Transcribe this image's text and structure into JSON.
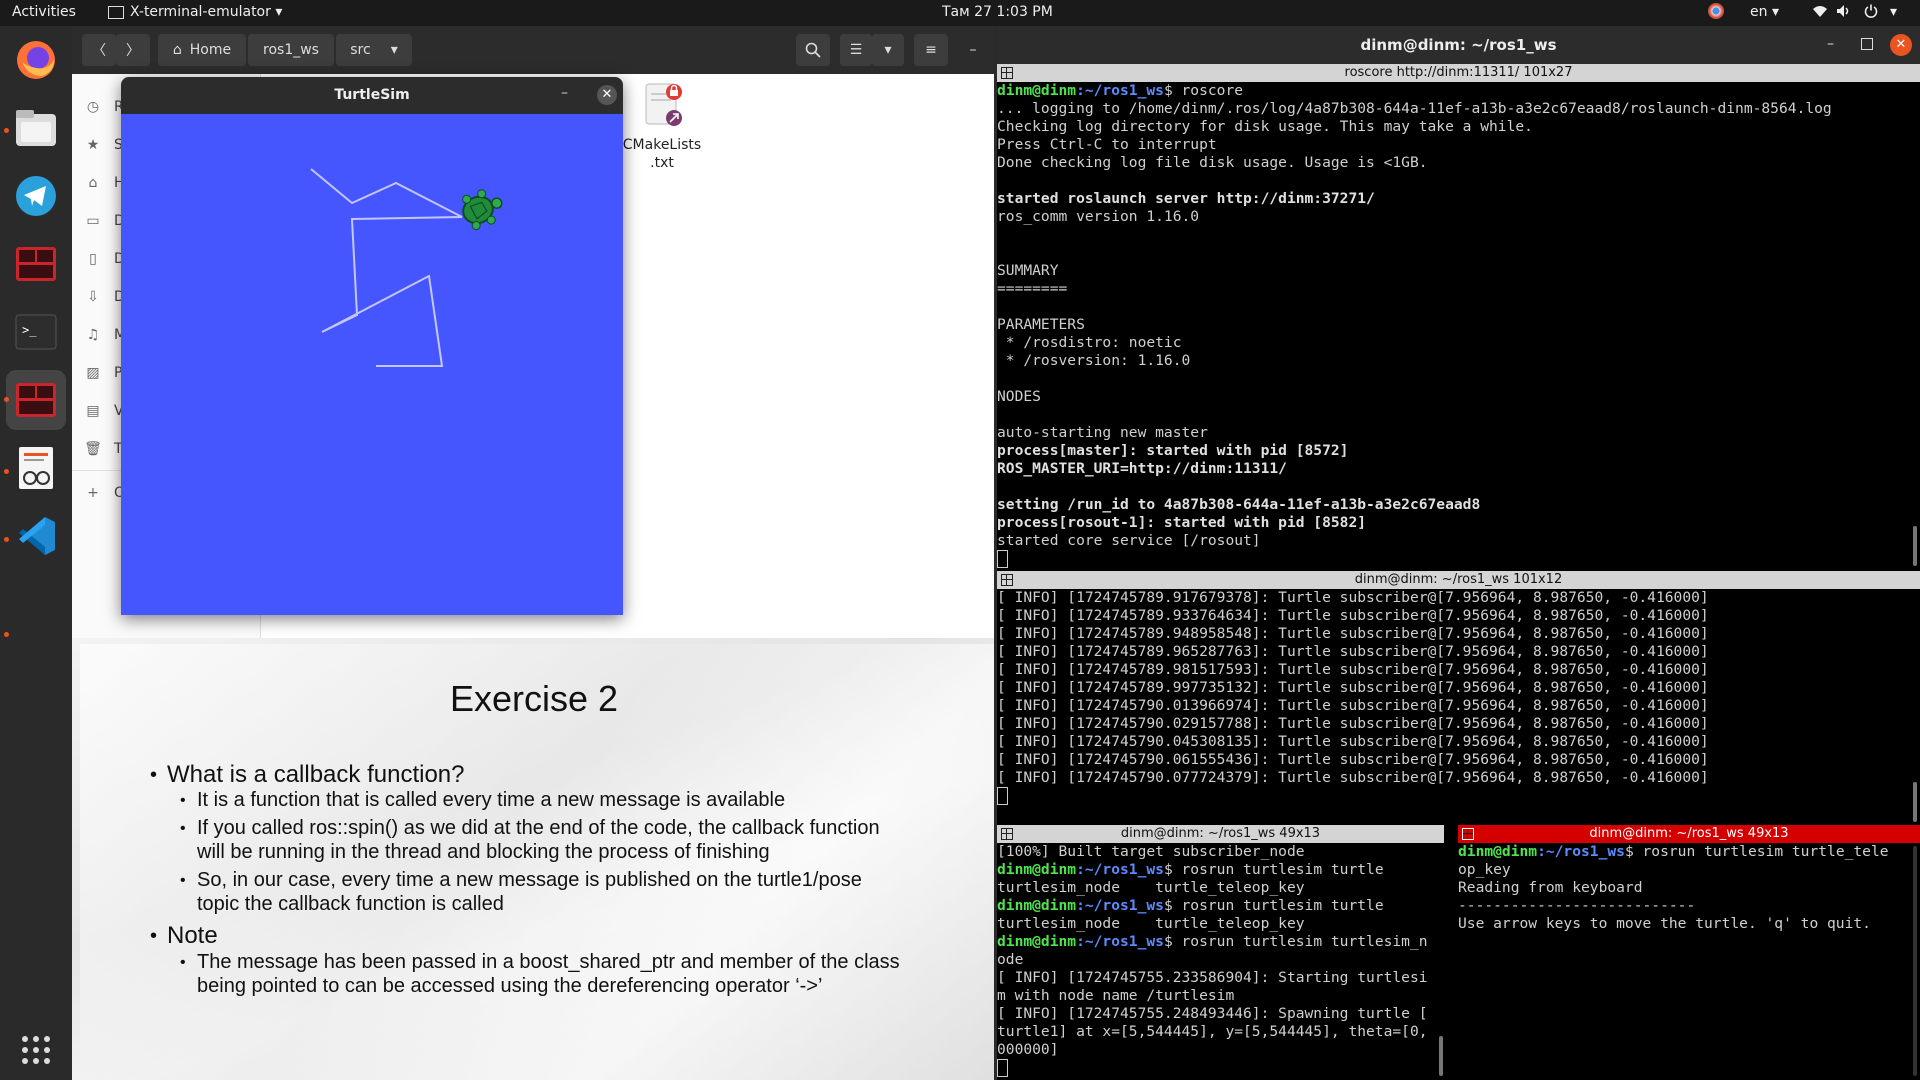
{
  "topbar": {
    "activities": "Activities",
    "app_menu": "X-terminal-emulator",
    "clock": "Там 27  1:03 PM",
    "lang": "en"
  },
  "file_manager": {
    "nav_home": "Home",
    "crumb_ros1_ws": "ros1_ws",
    "crumb_src": "src",
    "file_name_line1": "CMakeLists",
    "file_name_line2": ".txt",
    "sidebar_items": [
      "Re",
      "St",
      "Ho",
      "De",
      "Do",
      "Do",
      "M",
      "Pi",
      "Vi",
      "Tr",
      "O"
    ]
  },
  "turtlesim": {
    "title": "TurtleSim",
    "background": "#4556ff"
  },
  "slide": {
    "title": "Exercise 2",
    "bullets": [
      {
        "level": 1,
        "text": "What is a callback function?"
      },
      {
        "level": 2,
        "text": "It is a function that is called every time a new message is available"
      },
      {
        "level": 2,
        "text": "If you called ros::spin() as we did at the end of the code, the callback function"
      },
      {
        "level": 0,
        "text": "will be running in the thread and blocking the process of finishing"
      },
      {
        "level": 2,
        "text": "So, in our case, every time a new message is published on the turtle1/pose"
      },
      {
        "level": 0,
        "text": "topic the callback function is called"
      },
      {
        "level": 1,
        "text": "Note"
      },
      {
        "level": 2,
        "text": "The message has been passed in a boost_shared_ptr and member of the class"
      },
      {
        "level": 0,
        "text": "being pointed to can be accessed using the dereferencing operator ‘->’"
      }
    ]
  },
  "terminal": {
    "window_title": "dinm@dinm: ~/ros1_ws",
    "pane1": {
      "title": "roscore http://dinm:11311/ 101x27",
      "prompt_user": "dinm@dinm",
      "prompt_path": ":~/ros1_ws",
      "command": "$ roscore",
      "lines": [
        {
          "t": "... logging to /home/dinm/.ros/log/4a87b308-644a-11ef-a13b-a3e2c67eaad8/roslaunch-dinm-8564.log",
          "b": false
        },
        {
          "t": "Checking log directory for disk usage. This may take a while.",
          "b": false
        },
        {
          "t": "Press Ctrl-C to interrupt",
          "b": false
        },
        {
          "t": "Done checking log file disk usage. Usage is <1GB.",
          "b": false
        },
        {
          "t": "",
          "b": false
        },
        {
          "t": "started roslaunch server http://dinm:37271/",
          "b": true
        },
        {
          "t": "ros_comm version 1.16.0",
          "b": false
        },
        {
          "t": "",
          "b": false
        },
        {
          "t": "",
          "b": false
        },
        {
          "t": "SUMMARY",
          "b": false
        },
        {
          "t": "========",
          "b": false
        },
        {
          "t": "",
          "b": false
        },
        {
          "t": "PARAMETERS",
          "b": false
        },
        {
          "t": " * /rosdistro: noetic",
          "b": false
        },
        {
          "t": " * /rosversion: 1.16.0",
          "b": false
        },
        {
          "t": "",
          "b": false
        },
        {
          "t": "NODES",
          "b": false
        },
        {
          "t": "",
          "b": false
        },
        {
          "t": "auto-starting new master",
          "b": false
        },
        {
          "t": "process[master]: started with pid [8572]",
          "b": true
        },
        {
          "t": "ROS_MASTER_URI=http://dinm:11311/",
          "b": true
        },
        {
          "t": "",
          "b": false
        },
        {
          "t": "setting /run_id to 4a87b308-644a-11ef-a13b-a3e2c67eaad8",
          "b": true
        },
        {
          "t": "process[rosout-1]: started with pid [8582]",
          "b": true
        },
        {
          "t": "started core service [/rosout]",
          "b": false
        }
      ]
    },
    "pane2": {
      "title": "dinm@dinm: ~/ros1_ws 101x12",
      "lines": [
        "[ INFO] [1724745789.917679378]: Turtle subscriber@[7.956964, 8.987650, -0.416000]",
        "[ INFO] [1724745789.933764634]: Turtle subscriber@[7.956964, 8.987650, -0.416000]",
        "[ INFO] [1724745789.948958548]: Turtle subscriber@[7.956964, 8.987650, -0.416000]",
        "[ INFO] [1724745789.965287763]: Turtle subscriber@[7.956964, 8.987650, -0.416000]",
        "[ INFO] [1724745789.981517593]: Turtle subscriber@[7.956964, 8.987650, -0.416000]",
        "[ INFO] [1724745789.997735132]: Turtle subscriber@[7.956964, 8.987650, -0.416000]",
        "[ INFO] [1724745790.013966974]: Turtle subscriber@[7.956964, 8.987650, -0.416000]",
        "[ INFO] [1724745790.029157788]: Turtle subscriber@[7.956964, 8.987650, -0.416000]",
        "[ INFO] [1724745790.045308135]: Turtle subscriber@[7.956964, 8.987650, -0.416000]",
        "[ INFO] [1724745790.061555436]: Turtle subscriber@[7.956964, 8.987650, -0.416000]",
        "[ INFO] [1724745790.077724379]: Turtle subscriber@[7.956964, 8.987650, -0.416000]"
      ]
    },
    "pane3": {
      "title": "dinm@dinm: ~/ros1_ws 49x13",
      "lines": [
        {
          "u": "",
          "p": "",
          "t": "[100%] Built target subscriber_node"
        },
        {
          "u": "dinm@dinm",
          "p": ":~/ros1_ws",
          "t": "$ rosrun turtlesim turtle"
        },
        {
          "u": "",
          "p": "",
          "t": "turtlesim_node    turtle_teleop_key"
        },
        {
          "u": "dinm@dinm",
          "p": ":~/ros1_ws",
          "t": "$ rosrun turtlesim turtle"
        },
        {
          "u": "",
          "p": "",
          "t": "turtlesim_node    turtle_teleop_key"
        },
        {
          "u": "dinm@dinm",
          "p": ":~/ros1_ws",
          "t": "$ rosrun turtlesim turtlesim_n"
        },
        {
          "u": "",
          "p": "",
          "t": "ode"
        },
        {
          "u": "",
          "p": "",
          "t": "[ INFO] [1724745755.233586904]: Starting turtlesi"
        },
        {
          "u": "",
          "p": "",
          "t": "m with node name /turtlesim"
        },
        {
          "u": "",
          "p": "",
          "t": "[ INFO] [1724745755.248493446]: Spawning turtle ["
        },
        {
          "u": "",
          "p": "",
          "t": "turtle1] at x=[5,544445], y=[5,544445], theta=[0,"
        },
        {
          "u": "",
          "p": "",
          "t": "000000]"
        }
      ]
    },
    "pane4": {
      "title": "dinm@dinm: ~/ros1_ws 49x13",
      "lines": [
        {
          "u": "dinm@dinm",
          "p": ":~/ros1_ws",
          "t": "$ rosrun turtlesim turtle_tele"
        },
        {
          "u": "",
          "p": "",
          "t": "op_key"
        },
        {
          "u": "",
          "p": "",
          "t": "Reading from keyboard"
        },
        {
          "u": "",
          "p": "",
          "t": "---------------------------"
        },
        {
          "u": "",
          "p": "",
          "t": "Use arrow keys to move the turtle. 'q' to quit."
        }
      ]
    }
  },
  "icons": {
    "dock": [
      "firefox-icon",
      "files-icon",
      "telegram-icon",
      "terminal-red-icon",
      "terminal-icon",
      "terminal-red-active-icon",
      "document-viewer-icon",
      "vscode-icon",
      "app-grid-icon"
    ]
  },
  "colors": {
    "prompt_user": "#4ee44e",
    "prompt_path": "#5d8cff",
    "active_pane": "#d40000"
  }
}
